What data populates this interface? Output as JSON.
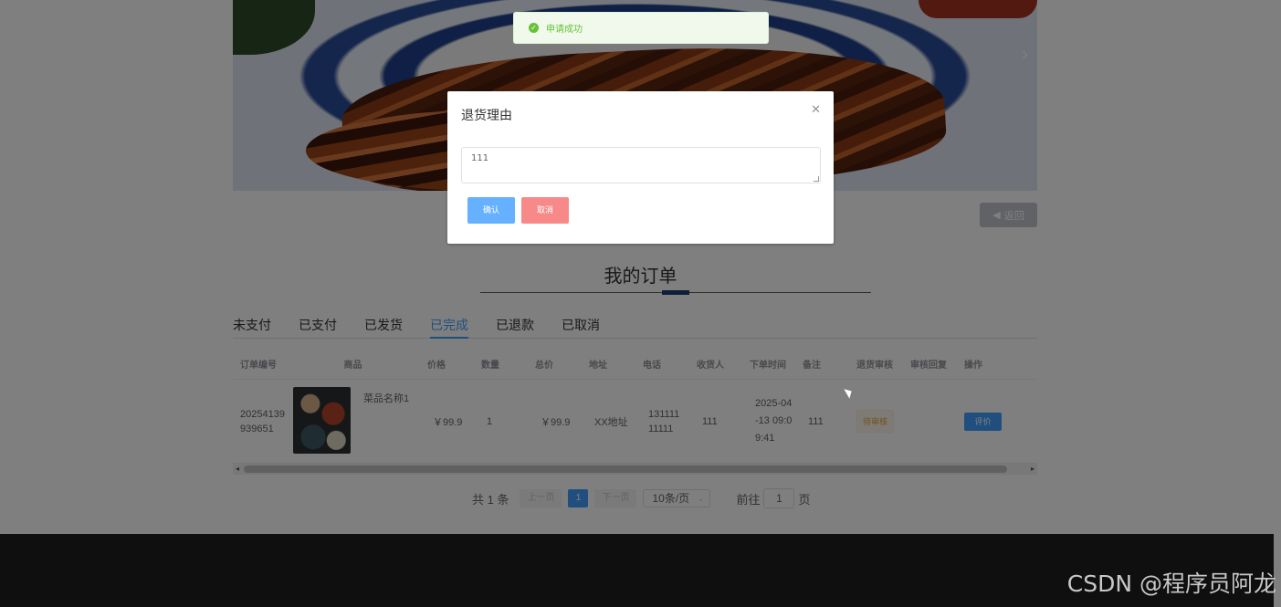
{
  "back_button": {
    "label": "返回"
  },
  "section": {
    "title": "我的订单"
  },
  "tabs": [
    "未支付",
    "已支付",
    "已发货",
    "已完成",
    "已退款",
    "已取消"
  ],
  "active_tab": "已完成",
  "table": {
    "headers": [
      "订单编号",
      "商品",
      "价格",
      "数量",
      "总价",
      "地址",
      "电话",
      "收货人",
      "下单时间",
      "备注",
      "退货审核",
      "审核回复",
      "操作"
    ],
    "rows": [
      {
        "order_no": "20254139939651",
        "goods_name": "菜品名称1",
        "price": "￥99.9",
        "quantity": "1",
        "total": "￥99.9",
        "address": "XX地址",
        "phone": "13111111111",
        "receiver": "111",
        "order_time": "2025-04-13 09:09:41",
        "remark": "111",
        "return_status": "待审核",
        "audit_reply": "",
        "action": "评价"
      }
    ]
  },
  "pagination": {
    "total": "共 1 条",
    "prev": "上一页",
    "current": "1",
    "next": "下一页",
    "page_size": "10条/页",
    "goto_label": "前往",
    "goto_value": "1",
    "page_unit": "页"
  },
  "toast": {
    "message": "申请成功",
    "color": "#67c23a"
  },
  "dialog": {
    "title": "退货理由",
    "reason_value": "111",
    "confirm_label": "确认",
    "cancel_label": "取消"
  },
  "watermark": "CSDN @程序员阿龙",
  "colors": {
    "primary": "#409eff",
    "danger": "#f78989",
    "warning": "#e6a23c",
    "footer": "#1f1f1f"
  }
}
